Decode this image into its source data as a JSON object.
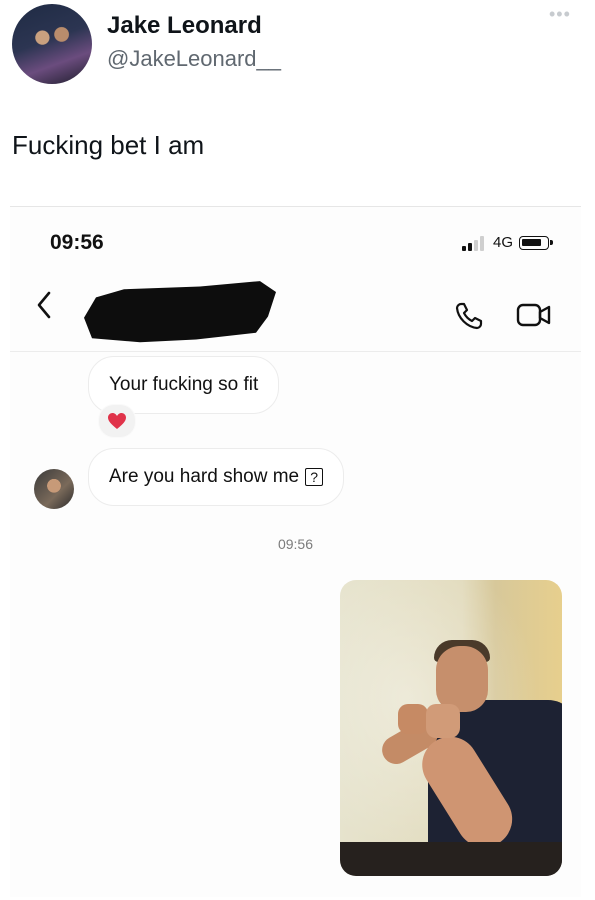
{
  "tweet": {
    "display_name": "Jake Leonard",
    "handle": "@JakeLeonard__",
    "more_icon": "more-dots-icon",
    "text": "Fucking bet I am"
  },
  "phone": {
    "status_time": "09:56",
    "network": "4G",
    "signal_bars": 2,
    "signal_max": 4,
    "battery_level": 0.75
  },
  "dm": {
    "contact_name_redacted": true,
    "messages": [
      {
        "text": "Your fucking so fit",
        "reaction": "red-heart"
      },
      {
        "text": "Are you hard show me",
        "glyph": "?"
      }
    ],
    "timestamp": "09:56",
    "sent_photo": "photo-man-fist-pose"
  },
  "colors": {
    "text_primary": "#0f1419",
    "handle_gray": "#606870",
    "heart_red": "#e0334a",
    "bubble_border": "#ececec"
  }
}
